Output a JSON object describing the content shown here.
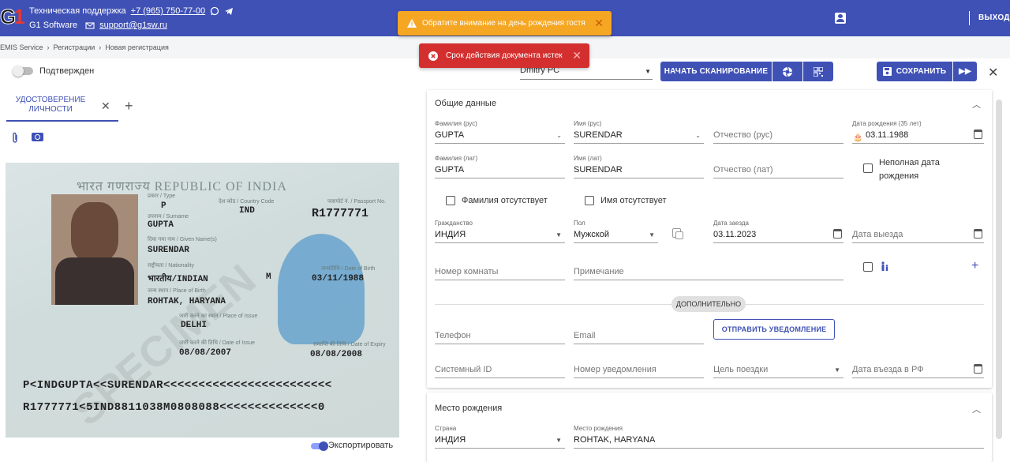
{
  "header": {
    "support_label": "Техническая поддержка",
    "phone": "+7 (965) 750-77-00",
    "company": "G1 Software",
    "email": "support@g1sw.ru",
    "logout": "ВЫХОД",
    "logo_text": "G1"
  },
  "toasts": {
    "warning": "Обратите внимание на день рождения гостя",
    "error": "Срок действия документа истек"
  },
  "breadcrumb": [
    "EMIS Service",
    "Регистрации",
    "Новая регистрация"
  ],
  "left": {
    "confirmed_label": "Подтвержден",
    "tab_label": "УДОСТОВЕРЕНИЕ ЛИЧНОСТИ",
    "export_label": "Экспортировать"
  },
  "passport": {
    "header": "भारत गणराज्य  REPUBLIC OF INDIA",
    "type_label": "प्रकार / Type",
    "type": "P",
    "country_label": "देश कोड / Country Code",
    "country": "IND",
    "passport_no_label": "पासपोर्ट नं. / Passport No.",
    "passport_no": "R1777771",
    "surname_label": "उपनाम / Surname",
    "surname": "GUPTA",
    "given_label": "दिया गया नाम / Given Name(s)",
    "given": "SURENDAR",
    "nationality_label": "राष्ट्रीयता / Nationality",
    "nationality": "भारतीय/INDIAN",
    "sex": "M",
    "dob_label": "जन्मतिथि / Date of Birth",
    "dob": "03/11/1988",
    "pob_label": "जन्म स्थान / Place of Birth",
    "pob": "ROHTAK, HARYANA",
    "poi_label": "जारी करने का स्थान / Place of Issue",
    "poi": "DELHI",
    "doi_label": "जारी करने की तिथि / Date of Issue",
    "doi": "08/08/2007",
    "doe_label": "समाप्ति की तिथि / Date of Expiry",
    "doe": "08/08/2008",
    "watermark": "SPECIMEN",
    "mrz1": "P<INDGUPTA<<SURENDAR<<<<<<<<<<<<<<<<<<<<<<<<",
    "mrz2": "R1777771<5IND8811038M0808088<<<<<<<<<<<<<<0"
  },
  "toolbar": {
    "device": "Dmitry PC",
    "scan_label": "НАЧАТЬ СКАНИРОВАНИЕ",
    "save_label": "СОХРАНИТЬ"
  },
  "general": {
    "title": "Общие данные",
    "surname_ru_label": "Фамилия (рус)",
    "surname_ru": "GUPTA",
    "name_ru_label": "Имя (рус)",
    "name_ru": "SURENDAR",
    "patronymic_ru_ph": "Отчество (рус)",
    "dob_label": "Дата рождения (35 лет)",
    "dob": "03.11.1988",
    "surname_lat_label": "Фамилия (лат)",
    "surname_lat": "GUPTA",
    "name_lat_label": "Имя (лат)",
    "name_lat": "SURENDAR",
    "patronymic_lat_ph": "Отчество (лат)",
    "incomplete_dob": "Неполная дата рождения",
    "no_surname": "Фамилия отсутствует",
    "no_name": "Имя отсутствует",
    "citizenship_label": "Гражданство",
    "citizenship": "ИНДИЯ",
    "sex_label": "Пол",
    "sex": "Мужской",
    "arrival_label": "Дата заезда",
    "arrival": "03.11.2023",
    "departure_ph": "Дата выезда",
    "room_ph": "Номер комнаты",
    "note_ph": "Примечание",
    "extra_chip": "ДОПОЛНИТЕЛЬНО",
    "phone_ph": "Телефон",
    "email_ph": "Email",
    "send_notify": "ОТПРАВИТЬ УВЕДОМЛЕНИЕ",
    "system_id_ph": "Системный ID",
    "notify_no_ph": "Номер уведомления",
    "purpose_ph": "Цель поездки",
    "entry_rf_ph": "Дата въезда в РФ"
  },
  "birthplace": {
    "title": "Место рождения",
    "country_label": "Страна",
    "country": "ИНДИЯ",
    "place_label": "Место рождения",
    "place": "ROHTAK, HARYANA"
  },
  "colors": {
    "primary": "#3f51b5",
    "warning": "#f5a623",
    "error": "#d32f2f"
  }
}
